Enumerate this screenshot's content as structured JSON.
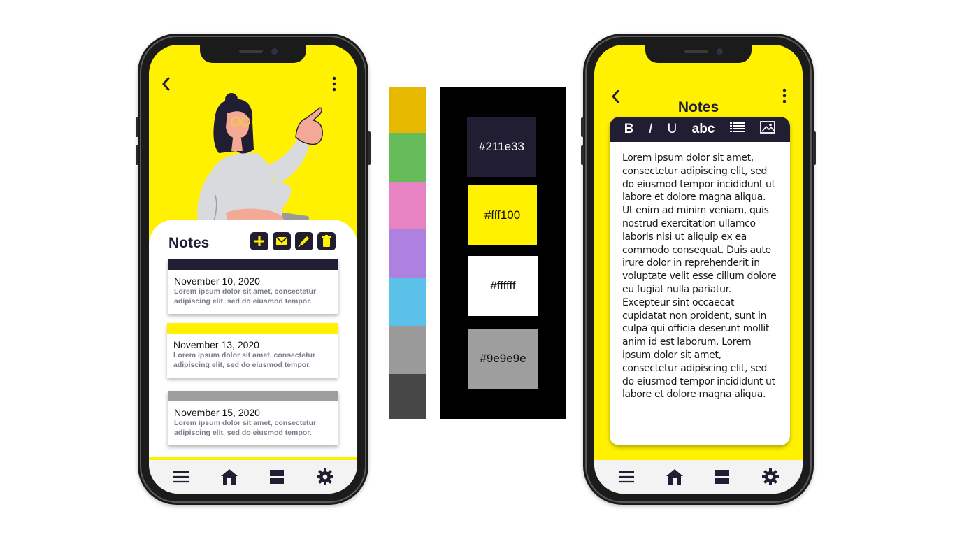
{
  "colors": {
    "dark": "#211e33",
    "yellow": "#fff100",
    "white": "#ffffff",
    "gray": "#9e9e9e",
    "screen_bg": "#fff100"
  },
  "left_phone": {
    "icons": {
      "back": "chevron-left-icon",
      "menu": "more-vertical-icon"
    },
    "sheet": {
      "title": "Notes",
      "tools": [
        "plus-icon",
        "mail-icon",
        "pencil-icon",
        "trash-icon"
      ]
    },
    "notes": [
      {
        "date": "November 10, 2020",
        "text": "Lorem ipsum dolor sit amet, consectetur adipiscing elit, sed do eiusmod tempor.",
        "bar_color": "#211e33"
      },
      {
        "date": "November 13, 2020",
        "text": "Lorem ipsum dolor sit amet, consectetur adipiscing elit, sed do eiusmod tempor.",
        "bar_color": "#fff100"
      },
      {
        "date": "November 15, 2020",
        "text": "Lorem ipsum dolor sit amet, consectetur adipiscing elit, sed do eiusmod tempor.",
        "bar_color": "#9e9e9e"
      }
    ],
    "bottom_nav": [
      "menu-icon",
      "home-icon",
      "layout-icon",
      "settings-icon"
    ]
  },
  "palette_strip": [
    "#e6b800",
    "#66bb5a",
    "#e783c2",
    "#ae80e0",
    "#5bc1e8",
    "#9a9a9a",
    "#474747"
  ],
  "swatches": [
    {
      "label": "#211e33",
      "bg": "#211e33",
      "fg": "#ffffff"
    },
    {
      "label": "#fff100",
      "bg": "#fff100",
      "fg": "#111111"
    },
    {
      "label": "#ffffff",
      "bg": "#ffffff",
      "fg": "#111111"
    },
    {
      "label": "#9e9e9e",
      "bg": "#9e9e9e",
      "fg": "#111111"
    }
  ],
  "right_phone": {
    "title": "Notes",
    "toolbar": {
      "bold": "B",
      "italic": "I",
      "underline": "U",
      "strike": "abc"
    },
    "body": "Lorem ipsum dolor sit amet, consectetur adipiscing elit, sed do eiusmod tempor incididunt ut labore et dolore magna aliqua. Ut enim ad minim veniam, quis nostrud exercitation ullamco laboris nisi ut aliquip ex ea commodo consequat. Duis aute irure dolor in reprehenderit in voluptate velit esse cillum dolore eu fugiat nulla pariatur. Excepteur sint occaecat cupidatat non proident, sunt in culpa qui officia deserunt mollit anim id est laborum. Lorem ipsum dolor sit amet, consectetur adipiscing elit, sed do eiusmod tempor incididunt ut labore et dolore magna aliqua."
  }
}
